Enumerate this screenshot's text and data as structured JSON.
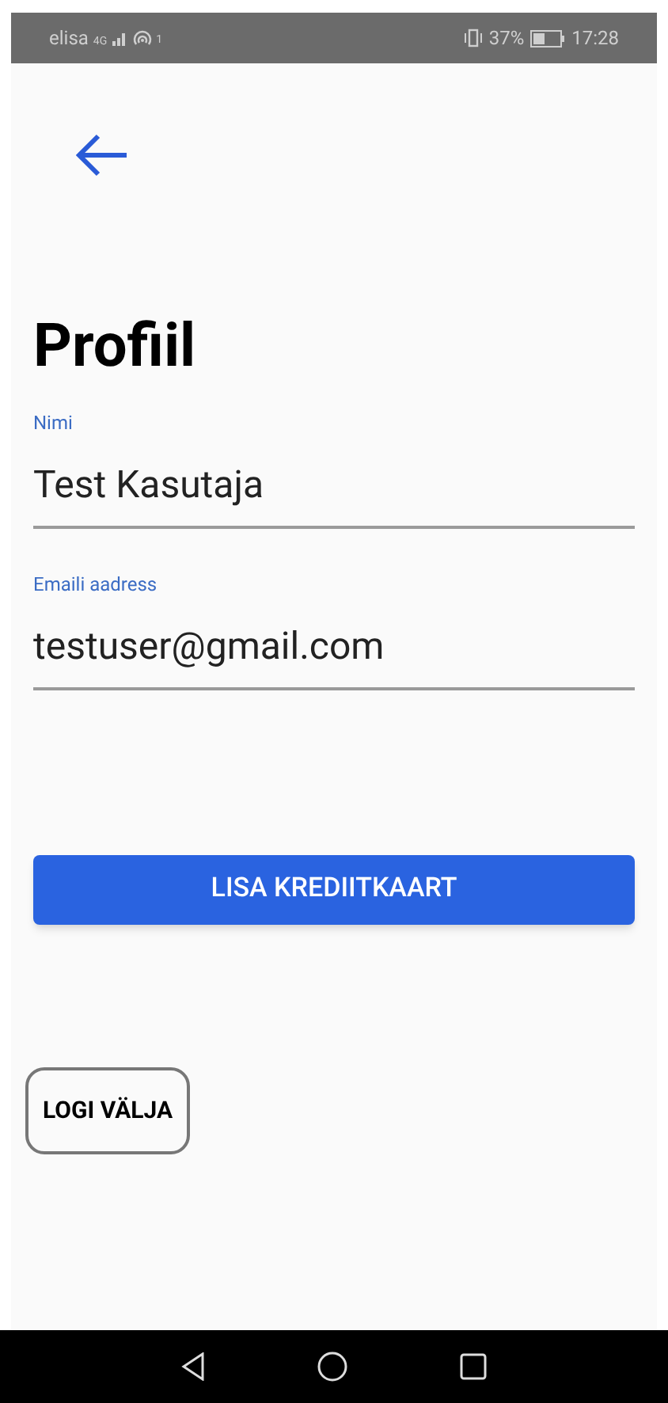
{
  "status_bar": {
    "carrier": "elisa",
    "network": "4G",
    "hotspot_count": "1",
    "battery_percent": "37%",
    "time": "17:28"
  },
  "title": "Profiil",
  "fields": [
    {
      "label": "Nimi",
      "value": "Test Kasutaja"
    },
    {
      "label": "Emaili aadress",
      "value": "testuser@gmail.com"
    }
  ],
  "primary_button": "LISA KREDIITKAART",
  "logout_button": "LOGI VÄLJA"
}
